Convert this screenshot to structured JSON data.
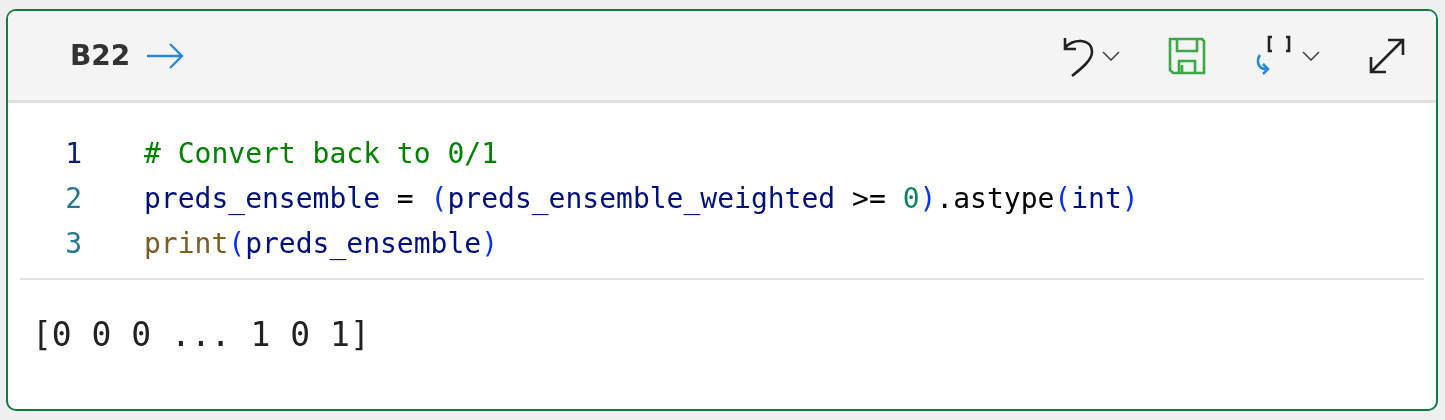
{
  "cell": {
    "label": "B22"
  },
  "toolbar": [
    {
      "kind": "undo",
      "has_menu": true
    },
    {
      "kind": "save",
      "has_menu": false
    },
    {
      "kind": "format",
      "has_menu": true
    },
    {
      "kind": "expand",
      "has_menu": false
    }
  ],
  "code_lines": [
    {
      "number": "1",
      "current": true,
      "tokens": [
        {
          "kind": "comment",
          "text": "# Convert back to 0/1"
        }
      ]
    },
    {
      "number": "2",
      "current": false,
      "tokens": [
        {
          "kind": "name",
          "text": "preds_ensemble"
        },
        {
          "kind": "plain",
          "text": " = "
        },
        {
          "kind": "paren",
          "text": "("
        },
        {
          "kind": "name",
          "text": "preds_ensemble_weighted"
        },
        {
          "kind": "plain",
          "text": " >= "
        },
        {
          "kind": "number",
          "text": "0"
        },
        {
          "kind": "paren",
          "text": ")"
        },
        {
          "kind": "plain",
          "text": ".astype"
        },
        {
          "kind": "paren",
          "text": "("
        },
        {
          "kind": "name",
          "text": "int"
        },
        {
          "kind": "paren",
          "text": ")"
        }
      ]
    },
    {
      "number": "3",
      "current": false,
      "tokens": [
        {
          "kind": "func",
          "text": "print"
        },
        {
          "kind": "paren",
          "text": "("
        },
        {
          "kind": "name",
          "text": "preds_ensemble"
        },
        {
          "kind": "paren",
          "text": ")"
        }
      ]
    }
  ],
  "output": "[0 0 0 ... 1 0 1]"
}
